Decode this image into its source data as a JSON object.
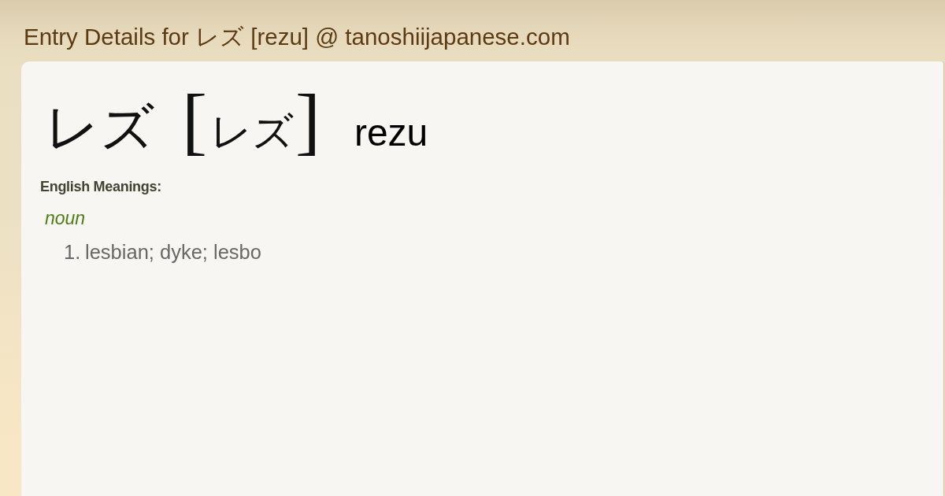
{
  "page_title": "Entry Details for レズ [rezu] @ tanoshiijapanese.com",
  "entry": {
    "headword": "レズ",
    "reading": {
      "bracket_open": "[",
      "kana": "レズ",
      "bracket_close": "]"
    },
    "romaji": "rezu"
  },
  "meanings": {
    "heading": "English Meanings:",
    "groups": [
      {
        "part_of_speech": "noun",
        "senses": [
          {
            "number": "1.",
            "text": "lesbian; dyke; lesbo"
          }
        ]
      }
    ]
  }
}
